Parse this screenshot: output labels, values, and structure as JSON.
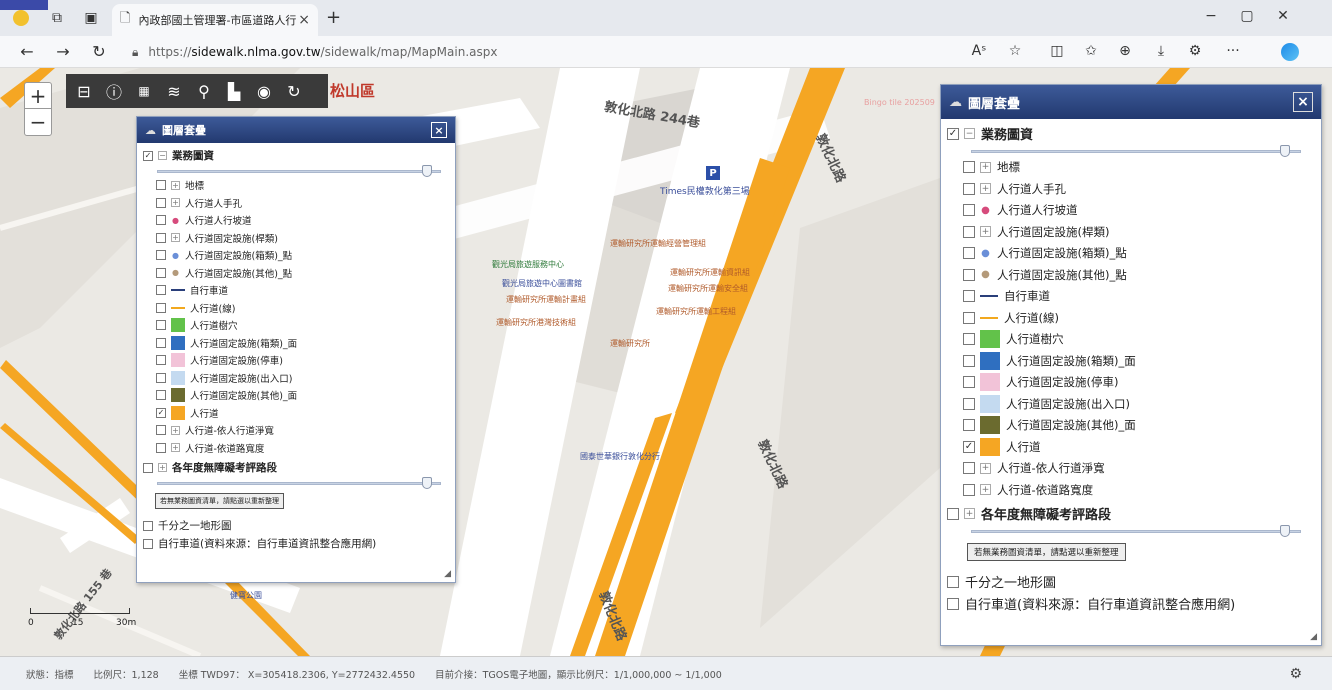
{
  "browser": {
    "tab_title": "內政部國土管理署-市區道路人行",
    "tab_close": "×",
    "new_tab": "+",
    "url_prefix": "https://",
    "url_domain": "sidewalk.nlma.gov.tw",
    "url_path": "/sidewalk/map/MapMain.aspx",
    "win_minimize": "−",
    "win_restore": "▢",
    "win_close": "✕",
    "ext_more": "···"
  },
  "map": {
    "district": "松山區",
    "watermark": "Bingo tile 202509",
    "roads": {
      "dunhua_244": "敦化北路 244巷",
      "dunhua_v1": "敦化北路",
      "dunhua_v2": "敦化北路",
      "dunhua_v3": "敦化北路",
      "lane_diag": "敦化北路 155 巷"
    },
    "parking_label": "P",
    "pois": {
      "times_parking": "Times民權敦化第三場",
      "p1": "運輸研究所運輸經營管理組",
      "p2": "觀光局旅遊服務中心",
      "p3": "運輸研究所運輸資訊組",
      "p4": "觀光局旅遊中心圖書館",
      "p5": "運輸研究所運輸安全組",
      "p6": "運輸研究所運輸計畫組",
      "p7": "運輸研究所港灣技術組",
      "p8": "運輸研究所運輸工程組",
      "p9": "運輸研究所",
      "bank": "國泰世華銀行敦化分行",
      "park": "健寶公園"
    },
    "scale_left": "0",
    "scale_mid": "15",
    "scale_right": "30m",
    "zoom_in": "+",
    "zoom_out": "−"
  },
  "panel": {
    "title": "圖層套疊",
    "close": "×",
    "group_business": "業務圖資",
    "layers": [
      {
        "label": "地標",
        "checked": false,
        "symbol": "expand"
      },
      {
        "label": "人行道人手孔",
        "checked": false,
        "symbol": "expand"
      },
      {
        "label": "人行道人行坡道",
        "checked": false,
        "symbol": "dot",
        "color": "#d64b7c"
      },
      {
        "label": "人行道固定設施(桿類)",
        "checked": false,
        "symbol": "expand"
      },
      {
        "label": "人行道固定設施(箱類)_點",
        "checked": false,
        "symbol": "dot",
        "color": "#6a8fd8"
      },
      {
        "label": "人行道固定設施(其他)_點",
        "checked": false,
        "symbol": "dot",
        "color": "#b49a7a"
      },
      {
        "label": "自行車道",
        "checked": false,
        "symbol": "line",
        "color": "#2a3f7a"
      },
      {
        "label": "人行道(線)",
        "checked": false,
        "symbol": "line",
        "color": "#f2a81e"
      },
      {
        "label": "人行道樹穴",
        "checked": false,
        "symbol": "swatch",
        "color": "#62c24a"
      },
      {
        "label": "人行道固定設施(箱類)_面",
        "checked": false,
        "symbol": "swatch",
        "color": "#2f6fc0"
      },
      {
        "label": "人行道固定設施(停車)",
        "checked": false,
        "symbol": "swatch",
        "color": "#f2c3d8"
      },
      {
        "label": "人行道固定設施(出入口)",
        "checked": false,
        "symbol": "swatch",
        "color": "#c4daf0"
      },
      {
        "label": "人行道固定設施(其他)_面",
        "checked": false,
        "symbol": "swatch",
        "color": "#6b6b2f"
      },
      {
        "label": "人行道",
        "checked": true,
        "symbol": "swatch",
        "color": "#f5a623"
      },
      {
        "label": "人行道-依人行道淨寬",
        "checked": false,
        "symbol": "expand"
      },
      {
        "label": "人行道-依道路寬度",
        "checked": false,
        "symbol": "expand"
      }
    ],
    "group_annual": "各年度無障礙考評路段",
    "reorder_button": "若無業務圖資清單，請點選以重新整理",
    "base_thousandth": "千分之一地形圖",
    "base_bikeway": "自行車道(資料來源：自行車道資訊整合應用網)",
    "business_opacity": 0.95,
    "annual_opacity": 0.95
  },
  "status": {
    "state": "狀態：指標",
    "scale": "比例尺：1,128",
    "coord": "坐標 TWD97： X=305418.2306, Y=2772432.4550",
    "basemap": "目前介接：TGOS電子地圖，顯示比例尺：1/1,000,000 ~ 1/1,000"
  },
  "colors": {
    "sidewalk_orange": "#f5a623",
    "panel_header": "#2c4784",
    "toolbar_bg": "#3a3a3a",
    "district_red": "#c0392b"
  }
}
